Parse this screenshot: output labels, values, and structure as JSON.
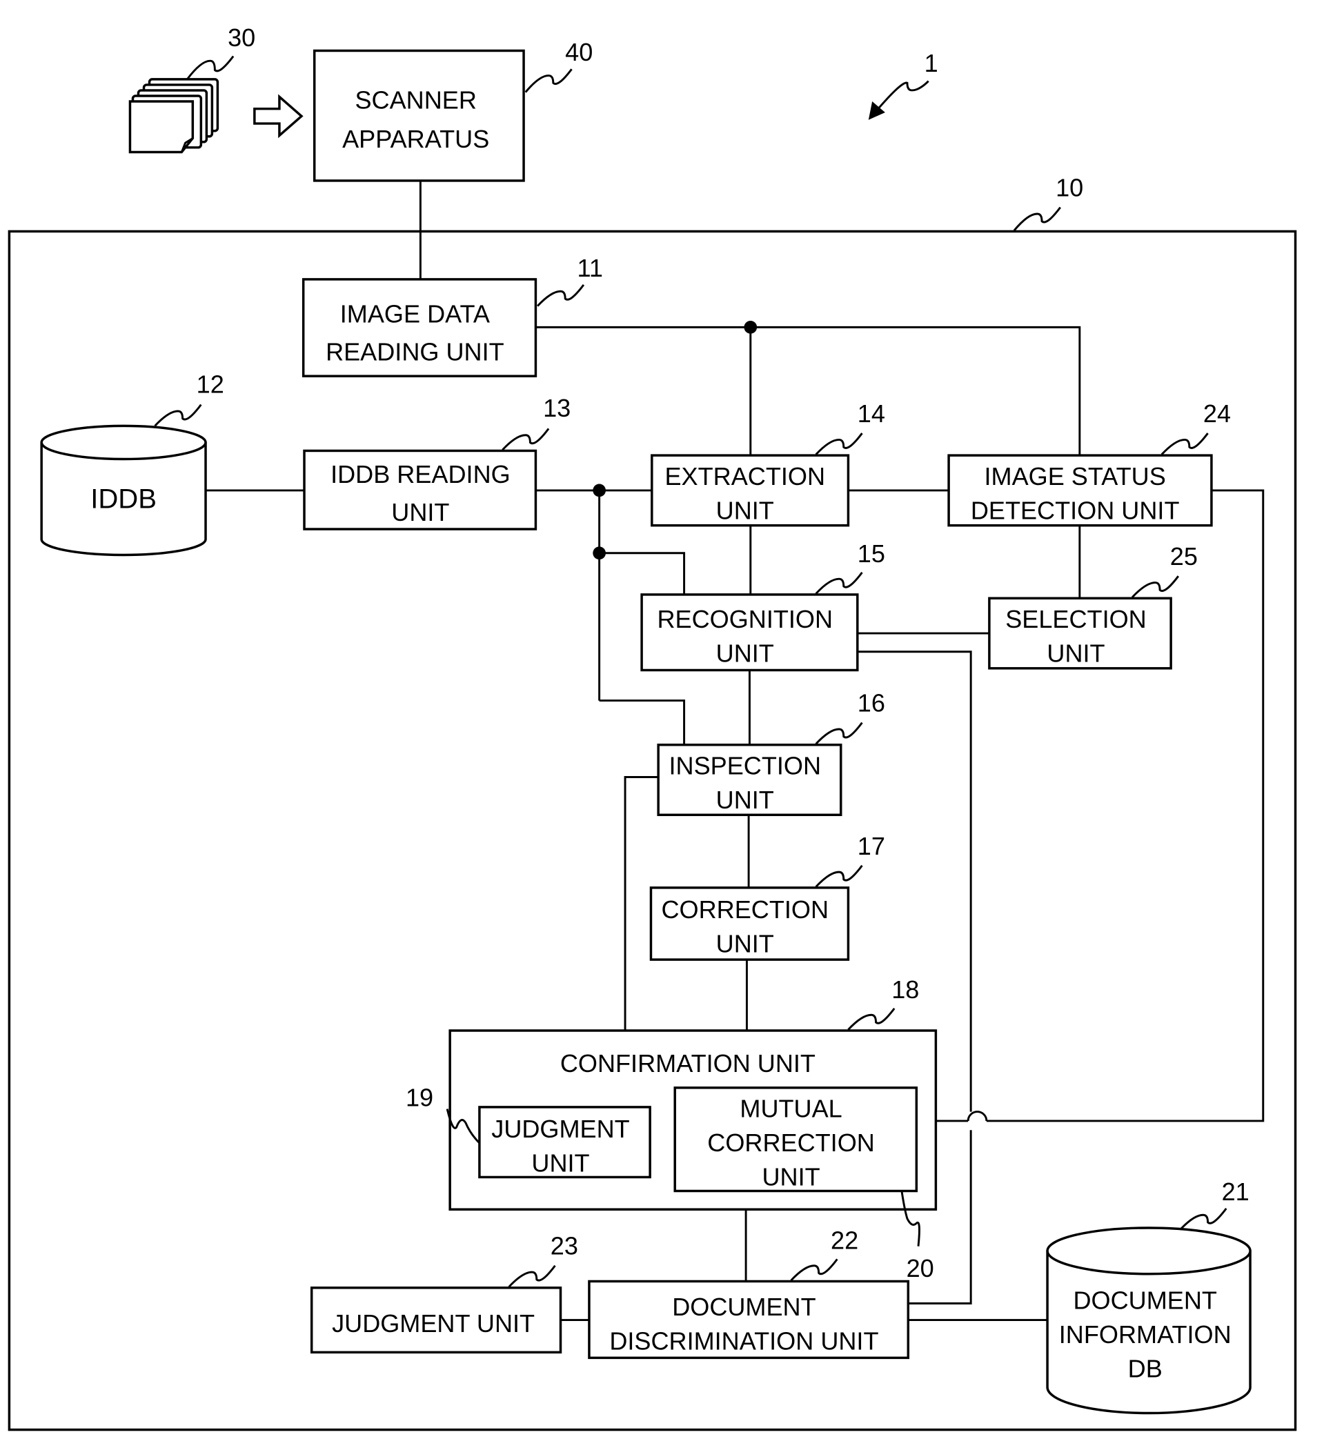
{
  "figure": {
    "system_ref": "1",
    "documents": {
      "ref": "30"
    },
    "scanner": {
      "ref": "40",
      "lines": [
        "SCANNER",
        "APPARATUS"
      ]
    },
    "apparatus": {
      "ref": "10"
    },
    "units": {
      "image_data_reading": {
        "ref": "11",
        "lines": [
          "IMAGE DATA",
          "READING UNIT"
        ]
      },
      "iddb": {
        "ref": "12",
        "lines": [
          "IDDB"
        ]
      },
      "iddb_reading": {
        "ref": "13",
        "lines": [
          "IDDB READING",
          "UNIT"
        ]
      },
      "extraction": {
        "ref": "14",
        "lines": [
          "EXTRACTION",
          "UNIT"
        ]
      },
      "recognition": {
        "ref": "15",
        "lines": [
          "RECOGNITION",
          "UNIT"
        ]
      },
      "inspection": {
        "ref": "16",
        "lines": [
          "INSPECTION",
          "UNIT"
        ]
      },
      "correction": {
        "ref": "17",
        "lines": [
          "CORRECTION",
          "UNIT"
        ]
      },
      "confirmation": {
        "ref": "18",
        "lines": [
          "CONFIRMATION UNIT"
        ]
      },
      "judgment_inner": {
        "ref": "19",
        "lines": [
          "JUDGMENT",
          "UNIT"
        ]
      },
      "mutual_correction": {
        "ref": "20",
        "lines": [
          "MUTUAL",
          "CORRECTION",
          "UNIT"
        ]
      },
      "document_info_db": {
        "ref": "21",
        "lines": [
          "DOCUMENT",
          "INFORMATION",
          "DB"
        ]
      },
      "document_discrimination": {
        "ref": "22",
        "lines": [
          "DOCUMENT",
          "DISCRIMINATION UNIT"
        ]
      },
      "judgment": {
        "ref": "23",
        "lines": [
          "JUDGMENT UNIT"
        ]
      },
      "image_status_detection": {
        "ref": "24",
        "lines": [
          "IMAGE STATUS",
          "DETECTION UNIT"
        ]
      },
      "selection": {
        "ref": "25",
        "lines": [
          "SELECTION",
          "UNIT"
        ]
      }
    }
  }
}
